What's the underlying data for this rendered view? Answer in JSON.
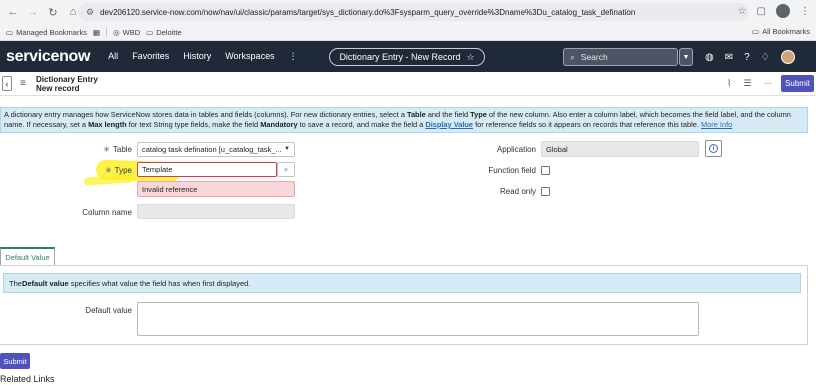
{
  "browser": {
    "url": "dev206120.service-now.com/now/nav/ui/classic/params/target/sys_dictionary.do%3Fsysparm_query_override%3Dname%3Du_catalog_task_defination",
    "bookmarks": [
      {
        "label": "Managed Bookmarks"
      },
      {
        "label": "WBD"
      },
      {
        "label": "Deloitte"
      }
    ],
    "all_bookmarks": "All Bookmarks"
  },
  "header": {
    "logo": "servicenow",
    "nav": [
      "All",
      "Favorites",
      "History",
      "Workspaces"
    ],
    "context_pill": "Dictionary Entry - New Record",
    "search_placeholder": "Search"
  },
  "form_header": {
    "title_line1": "Dictionary Entry",
    "title_line2": "New record",
    "submit_label": "Submit"
  },
  "info": {
    "text_a": "A dictionary entry manages how ServiceNow stores data in tables and fields (columns). For new dictionary entries, select a ",
    "bold_table": "Table",
    "text_b": " and the field ",
    "bold_type": "Type",
    "text_c": " of the new column. Also enter a column label, which becomes the field label, and the column name. If necessary, set a ",
    "bold_maxlen": "Max length",
    "text_d": " for text String type fields, make the field ",
    "bold_mandatory": "Mandatory",
    "text_e": " to save a record, and make the field a ",
    "bold_display": "Display Value",
    "text_f": " for reference fields so it appears on records that reference this table. ",
    "more_info": "More Info"
  },
  "fields": {
    "table_label": "Table",
    "table_value": "catalog task defination [u_catalog_task_...",
    "type_label": "Type",
    "type_value": "Template",
    "type_error": "Invalid reference",
    "column_name_label": "Column name",
    "column_name_value": "",
    "application_label": "Application",
    "application_value": "Global",
    "function_field_label": "Function field",
    "read_only_label": "Read only"
  },
  "tabs": {
    "default_value_tab": "Default Value"
  },
  "default_value": {
    "banner_pre": "The ",
    "banner_bold": "Default value",
    "banner_post": " specifies what value the field has when first displayed.",
    "label": "Default value",
    "value": ""
  },
  "footer": {
    "submit_label": "Submit",
    "related_links": "Related Links"
  },
  "colors": {
    "header_bg": "#1f2937",
    "submit_bg": "#4f52bd",
    "info_bg": "#d7ebf7",
    "error_bg": "#f8d7da",
    "highlight": "#fcf028"
  }
}
